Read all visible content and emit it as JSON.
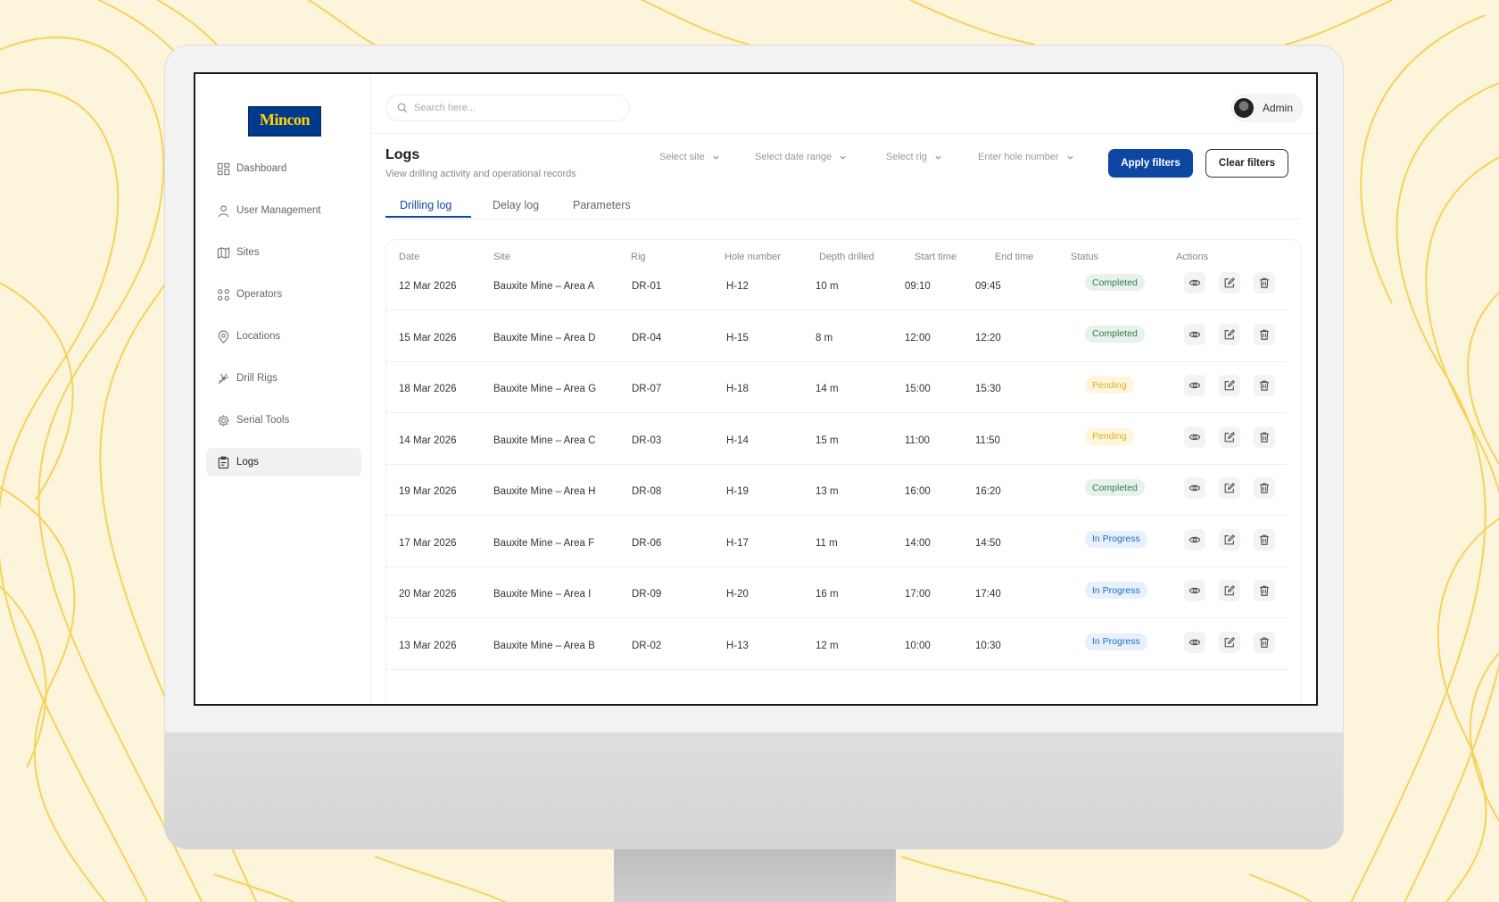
{
  "app": {
    "logo_text": "Mincon"
  },
  "sidebar": {
    "items": [
      {
        "label": "Dashboard",
        "icon": "dashboard-icon"
      },
      {
        "label": "User Management",
        "icon": "user-icon"
      },
      {
        "label": "Sites",
        "icon": "map-icon"
      },
      {
        "label": "Operators",
        "icon": "operators-icon"
      },
      {
        "label": "Locations",
        "icon": "location-pin-icon"
      },
      {
        "label": "Drill Rigs",
        "icon": "drill-rig-icon"
      },
      {
        "label": "Serial Tools",
        "icon": "gear-icon"
      },
      {
        "label": "Logs",
        "icon": "clipboard-icon",
        "active": true
      }
    ]
  },
  "header": {
    "search_placeholder": "Search here...",
    "user_name": "Admin"
  },
  "page": {
    "title": "Logs",
    "subtitle": "View drilling activity and operational records"
  },
  "filters": {
    "site": "Select site",
    "date_range": "Select date range",
    "rig": "Select rig",
    "hole_number": "Enter hole number",
    "apply_label": "Apply filters",
    "clear_label": "Clear filters"
  },
  "tabs": [
    {
      "label": "Drilling log",
      "active": true
    },
    {
      "label": "Delay log"
    },
    {
      "label": "Parameters"
    }
  ],
  "table": {
    "columns": [
      "Date",
      "Site",
      "Rig",
      "Hole number",
      "Depth drilled",
      "Start time",
      "End time",
      "Status",
      "Actions"
    ],
    "rows": [
      {
        "date": "12 Mar 2026",
        "site": "Bauxite Mine – Area A",
        "rig": "DR-01",
        "hole": "H-12",
        "depth": "10 m",
        "start": "09:10",
        "end": "09:45",
        "status": "Completed"
      },
      {
        "date": "15 Mar 2026",
        "site": "Bauxite Mine – Area D",
        "rig": "DR-04",
        "hole": "H-15",
        "depth": "8 m",
        "start": "12:00",
        "end": "12:20",
        "status": "Completed"
      },
      {
        "date": "18 Mar 2026",
        "site": "Bauxite Mine – Area G",
        "rig": "DR-07",
        "hole": "H-18",
        "depth": "14 m",
        "start": "15:00",
        "end": "15:30",
        "status": "Pending"
      },
      {
        "date": "14 Mar 2026",
        "site": "Bauxite Mine – Area C",
        "rig": "DR-03",
        "hole": "H-14",
        "depth": "15 m",
        "start": "11:00",
        "end": "11:50",
        "status": "Pending"
      },
      {
        "date": "19 Mar 2026",
        "site": "Bauxite Mine – Area H",
        "rig": "DR-08",
        "hole": "H-19",
        "depth": "13 m",
        "start": "16:00",
        "end": "16:20",
        "status": "Completed"
      },
      {
        "date": "17 Mar 2026",
        "site": "Bauxite Mine – Area F",
        "rig": "DR-06",
        "hole": "H-17",
        "depth": "11 m",
        "start": "14:00",
        "end": "14:50",
        "status": "In Progress"
      },
      {
        "date": "20 Mar 2026",
        "site": "Bauxite Mine – Area I",
        "rig": "DR-09",
        "hole": "H-20",
        "depth": "16 m",
        "start": "17:00",
        "end": "17:40",
        "status": "In Progress"
      },
      {
        "date": "13 Mar 2026",
        "site": "Bauxite Mine – Area B",
        "rig": "DR-02",
        "hole": "H-13",
        "depth": "12 m",
        "start": "10:00",
        "end": "10:30",
        "status": "In Progress"
      }
    ]
  },
  "colors": {
    "primary": "#0d47a1",
    "background": "#fdf4dc",
    "completed": "#2e7d4f",
    "pending": "#e0b020",
    "in_progress": "#1e6ec8"
  }
}
